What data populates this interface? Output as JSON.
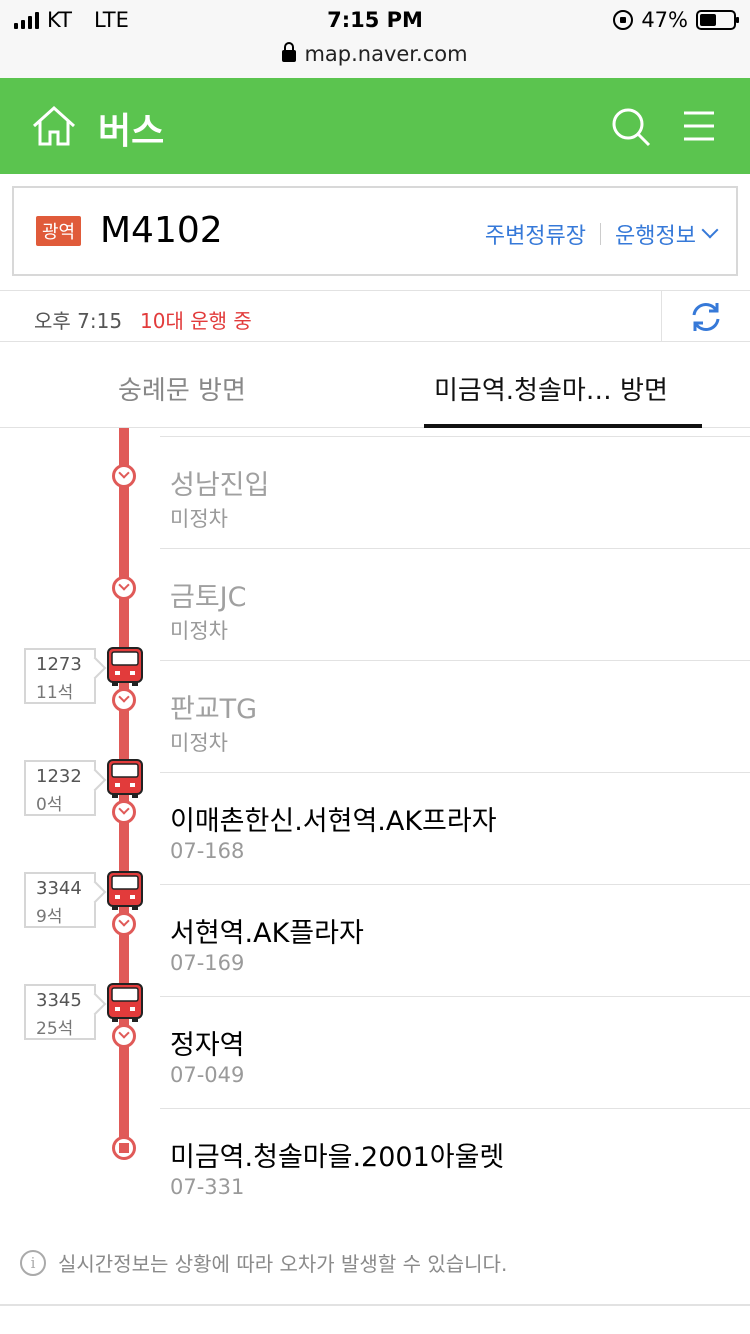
{
  "status_bar": {
    "carrier": "KT",
    "network": "LTE",
    "time": "7:15 PM",
    "battery": "47%"
  },
  "url": "map.naver.com",
  "header": {
    "title": "버스"
  },
  "route": {
    "badge": "광역",
    "number": "M4102",
    "link_nearby": "주변정류장",
    "link_info": "운행정보"
  },
  "info": {
    "time": "오후 7:15",
    "status": "10대 운행 중"
  },
  "tabs": [
    {
      "label": "숭례문 방면",
      "active": false
    },
    {
      "label": "미금역.청솔마… 방면",
      "active": true
    }
  ],
  "stops": [
    {
      "name": "성남진입",
      "sub": "미정차",
      "inactive": true
    },
    {
      "name": "금토JC",
      "sub": "미정차",
      "inactive": true
    },
    {
      "name": "판교TG",
      "sub": "미정차",
      "inactive": true
    },
    {
      "name": "이매촌한신.서현역.AK프라자",
      "sub": "07-168",
      "inactive": false
    },
    {
      "name": "서현역.AK플라자",
      "sub": "07-169",
      "inactive": false
    },
    {
      "name": "정자역",
      "sub": "07-049",
      "inactive": false
    },
    {
      "name": "미금역.청솔마을.2001아울렛",
      "sub": "07-331",
      "inactive": false
    }
  ],
  "buses": [
    {
      "number": "1273",
      "seats": "11석"
    },
    {
      "number": "1232",
      "seats": "0석"
    },
    {
      "number": "3344",
      "seats": "9석"
    },
    {
      "number": "3345",
      "seats": "25석"
    }
  ],
  "notice": "실시간정보는 상황에 따라 오차가 발생할 수 있습니다.",
  "colors": {
    "header_green": "#5bc44f",
    "route_red": "#e05a58",
    "link_blue": "#3679d8",
    "status_red": "#e23b3b",
    "badge_red": "#e05b3a"
  }
}
